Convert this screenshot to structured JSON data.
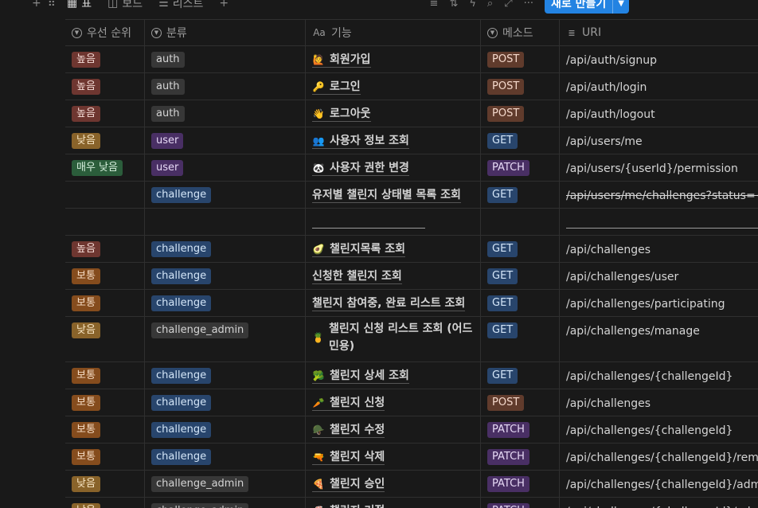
{
  "toolbar": {
    "views": [
      {
        "label": "표",
        "icon": "table-icon",
        "active": true
      },
      {
        "label": "보드",
        "icon": "board-icon",
        "active": false
      },
      {
        "label": "리스트",
        "icon": "list-icon",
        "active": false
      }
    ],
    "new_button": "새로 만들기"
  },
  "columns": [
    {
      "label": "우선 순위",
      "icon": "select-icon"
    },
    {
      "label": "분류",
      "icon": "select-icon"
    },
    {
      "label": "기능",
      "icon": "title-icon",
      "icon_text": "Aa"
    },
    {
      "label": "메소드",
      "icon": "select-icon"
    },
    {
      "label": "URI",
      "icon": "text-icon"
    }
  ],
  "colors": {
    "priority": {
      "높음": {
        "bg": "#6e3630",
        "fg": "#f3d9d4"
      },
      "낮음": {
        "bg": "#89632a",
        "fg": "#f8e6c4"
      },
      "보통": {
        "bg": "#854c1d",
        "fg": "#f5dcc4"
      },
      "매우 낮음": {
        "bg": "#2b5d3b",
        "fg": "#d6efdd"
      }
    },
    "category": {
      "auth": {
        "bg": "#373737",
        "fg": "#d4d4d4"
      },
      "user": {
        "bg": "#492f64",
        "fg": "#e6d9f5"
      },
      "challenge": {
        "bg": "#28456c",
        "fg": "#d4e6f8"
      },
      "challenge_admin": {
        "bg": "#373737",
        "fg": "#d4d4d4"
      }
    },
    "method": {
      "POST": {
        "bg": "#603b2c",
        "fg": "#f5d9cc"
      },
      "GET": {
        "bg": "#28456c",
        "fg": "#d4e6f8"
      },
      "PATCH": {
        "bg": "#492f64",
        "fg": "#e6d9f5"
      }
    }
  },
  "rows": [
    {
      "priority": "높음",
      "category": "auth",
      "emoji": "🙋",
      "name": "회원가입",
      "method": "POST",
      "uri": "/api/auth/signup"
    },
    {
      "priority": "높음",
      "category": "auth",
      "emoji": "🔑",
      "name": "로그인",
      "method": "POST",
      "uri": "/api/auth/login"
    },
    {
      "priority": "높음",
      "category": "auth",
      "emoji": "👋",
      "name": "로그아웃",
      "method": "POST",
      "uri": "/api/auth/logout"
    },
    {
      "priority": "낮음",
      "category": "user",
      "emoji": "👥",
      "name": "사용자 정보 조회",
      "method": "GET",
      "uri": "/api/users/me"
    },
    {
      "priority": "매우 낮음",
      "category": "user",
      "emoji": "🐼",
      "name": "사용자 권한 변경",
      "method": "PATCH",
      "uri": "/api/users/{userId}/permission"
    },
    {
      "priority": "",
      "category": "challenge",
      "emoji": "",
      "name": "유저별 챌린지 상태별 목록 조회",
      "method": "GET",
      "uri": "/api/users/me/challenges?status={part",
      "strike": true
    },
    {
      "priority": "",
      "category": "",
      "emoji": "",
      "name": "",
      "method": "",
      "uri": "",
      "blank": true
    },
    {
      "priority": "높음",
      "category": "challenge",
      "emoji": "🥑",
      "name": "챌린지목록 조회",
      "method": "GET",
      "uri": "/api/challenges"
    },
    {
      "priority": "보통",
      "category": "challenge",
      "emoji": "",
      "name": "신청한 챌린지 조회",
      "method": "GET",
      "uri": "/api/challenges/user"
    },
    {
      "priority": "보통",
      "category": "challenge",
      "emoji": "",
      "name": "챌린지 참여중, 완료 리스트 조회",
      "method": "GET",
      "uri": "/api/challenges/participating"
    },
    {
      "priority": "낮음",
      "category": "challenge_admin",
      "emoji": "🍍",
      "name": "챌린지 신청 리스트 조회 (어드민용)",
      "method": "GET",
      "uri": "/api/challenges/manage",
      "wrap": true
    },
    {
      "priority": "보통",
      "category": "challenge",
      "emoji": "🥦",
      "name": "챌린지 상세 조회",
      "method": "GET",
      "uri": "/api/challenges/{challengeId}"
    },
    {
      "priority": "보통",
      "category": "challenge",
      "emoji": "🥕",
      "name": "챌린지 신청",
      "method": "POST",
      "uri": "/api/challenges"
    },
    {
      "priority": "보통",
      "category": "challenge",
      "emoji": "🪖",
      "name": "챌린지 수정",
      "method": "PATCH",
      "uri": "/api/challenges/{challengeId}"
    },
    {
      "priority": "보통",
      "category": "challenge",
      "emoji": "🔫",
      "name": "챌린지 삭제",
      "method": "PATCH",
      "uri": "/api/challenges/{challengeId}/remove"
    },
    {
      "priority": "낮음",
      "category": "challenge_admin",
      "emoji": "🍕",
      "name": "챌린지 승인",
      "method": "PATCH",
      "uri": "/api/challenges/{challengeId}/admin/a"
    },
    {
      "priority": "낮음",
      "category": "challenge_admin",
      "emoji": "🌋",
      "name": "챌린지 거절",
      "method": "PATCH",
      "uri": "/api/challenges/{challengeId}/admin/r"
    }
  ]
}
